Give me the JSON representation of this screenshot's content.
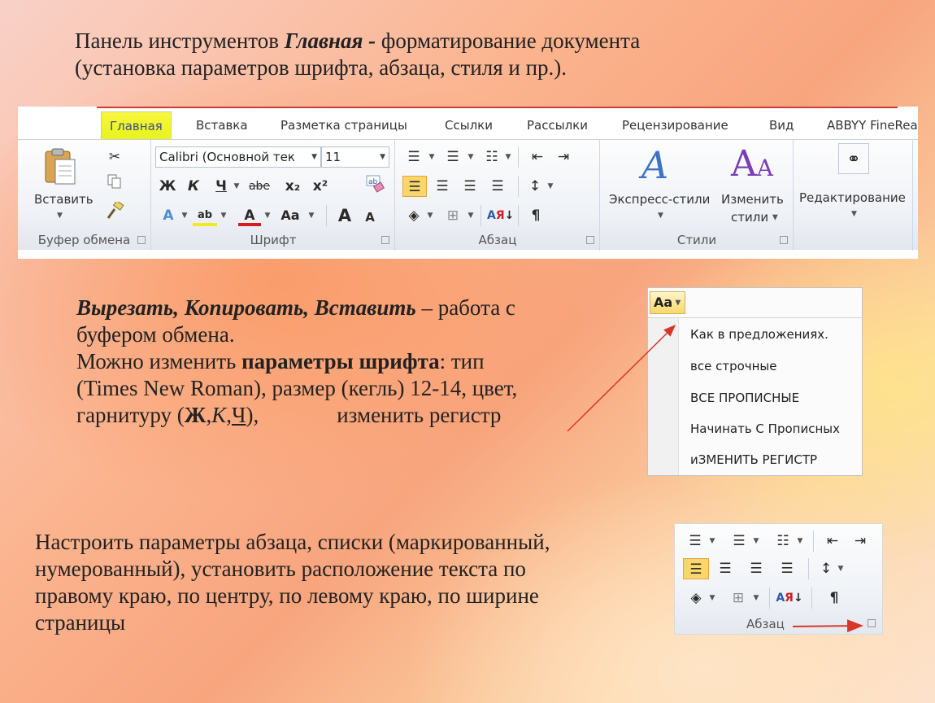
{
  "title": {
    "line1_pre": "Панель инструментов ",
    "line1_em": "Главная -",
    "line1_post": " форматирование документа",
    "line2": "(установка параметров шрифта, абзаца, стиля и пр.)."
  },
  "ribbon": {
    "tabs": [
      "Главная",
      "Вставка",
      "Разметка страницы",
      "Ссылки",
      "Рассылки",
      "Рецензирование",
      "Вид",
      "ABBYY FineRea"
    ],
    "active_tab": "Главная",
    "clipboard": {
      "paste_label": "Вставить",
      "group_label": "Буфер обмена"
    },
    "font": {
      "font_name": "Calibri (Основной тек",
      "font_size": "11",
      "bold": "Ж",
      "italic": "К",
      "underline": "Ч",
      "strike": "abe",
      "subscript": "x₂",
      "superscript": "x²",
      "grow": "A",
      "shrink": "A",
      "case": "Aa",
      "group_label": "Шрифт"
    },
    "paragraph": {
      "group_label": "Абзац",
      "pilcrow": "¶"
    },
    "styles": {
      "express": "Экспресс-стили",
      "change": "Изменить",
      "change2": "стили",
      "group_label": "Стили"
    },
    "editing": {
      "label": "Редактирование"
    }
  },
  "clipboard_text": {
    "em": "Вырезать, Копировать, Вставить",
    "line1_post": " – работа с",
    "line2": "буфером обмена.",
    "line3_pre": "Можно изменить  ",
    "line3_b": "параметры  шрифта",
    "line3_post": ": тип",
    "line4": "(Times New Roman), размер (кегль) 12-14, цвет,",
    "line5_pre": "гарнитуру (",
    "line5_b": "Ж",
    "line5_sep1": ",",
    "line5_i": "К",
    "line5_sep2": ",",
    "line5_u": "Ч",
    "line5_post": "),",
    "line5_tail": "изменить регистр"
  },
  "case_menu": {
    "button": "Aa",
    "items": [
      "Как в предложениях.",
      "все строчные",
      "ВСЕ ПРОПИСНЫЕ",
      "Начинать С Прописных",
      "иЗМЕНИТЬ РЕГИСТР"
    ]
  },
  "paragraph_text": {
    "line1": "Настроить параметры абзаца, списки (маркированный,",
    "line2": "нумерованный), установить расположение текста по",
    "line3": "правому краю, по центру, по левому краю, по ширине",
    "line4": "страницы"
  },
  "para_panel": {
    "group_label": "Абзац",
    "pilcrow": "¶"
  },
  "colors": {
    "accent_tab": "#e6f31c",
    "font_color": "#d11f1f",
    "arrow": "#d9362b"
  }
}
